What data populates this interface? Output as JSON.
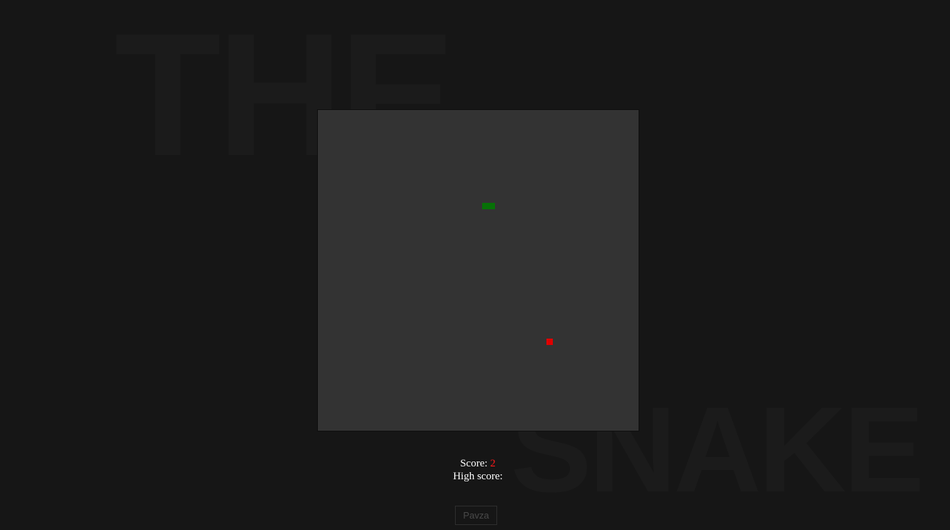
{
  "background": {
    "word_top": "THE",
    "word_bottom": "SNAKE"
  },
  "board": {
    "background_color": "#333333",
    "snake_color": "#077107",
    "food_color": "#e00000"
  },
  "score": {
    "label": "Score:",
    "value": "2",
    "high_label": "High score:",
    "high_value": ""
  },
  "controls": {
    "pause_label": "Pavza"
  }
}
